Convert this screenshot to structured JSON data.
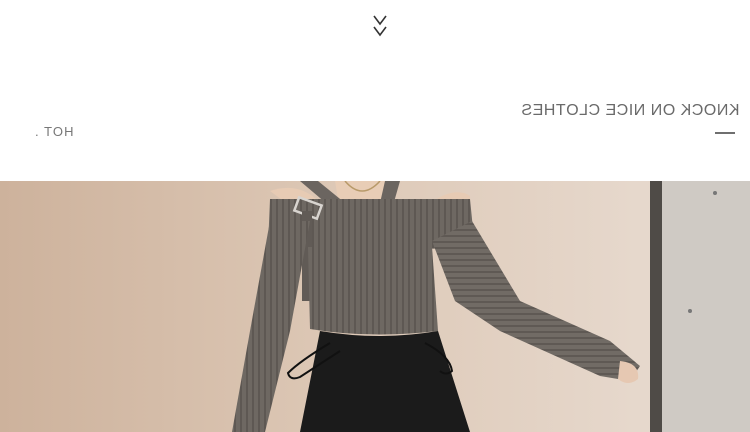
{
  "header": {
    "chevron_icon": "double-chevron-down-icon",
    "slogan_text": "KNOCK ON NICE CLOTHES",
    "tag_text": "HOT ."
  },
  "photo": {
    "subject": "model wearing grey ribbed off-shoulder halter crop sweater with buckle detail and black drawstring skirt",
    "colors": {
      "background_wall": "#d9c3b0",
      "sweater": "#6e6862",
      "skirt": "#1b1b1b",
      "door": "#5a5550"
    }
  }
}
